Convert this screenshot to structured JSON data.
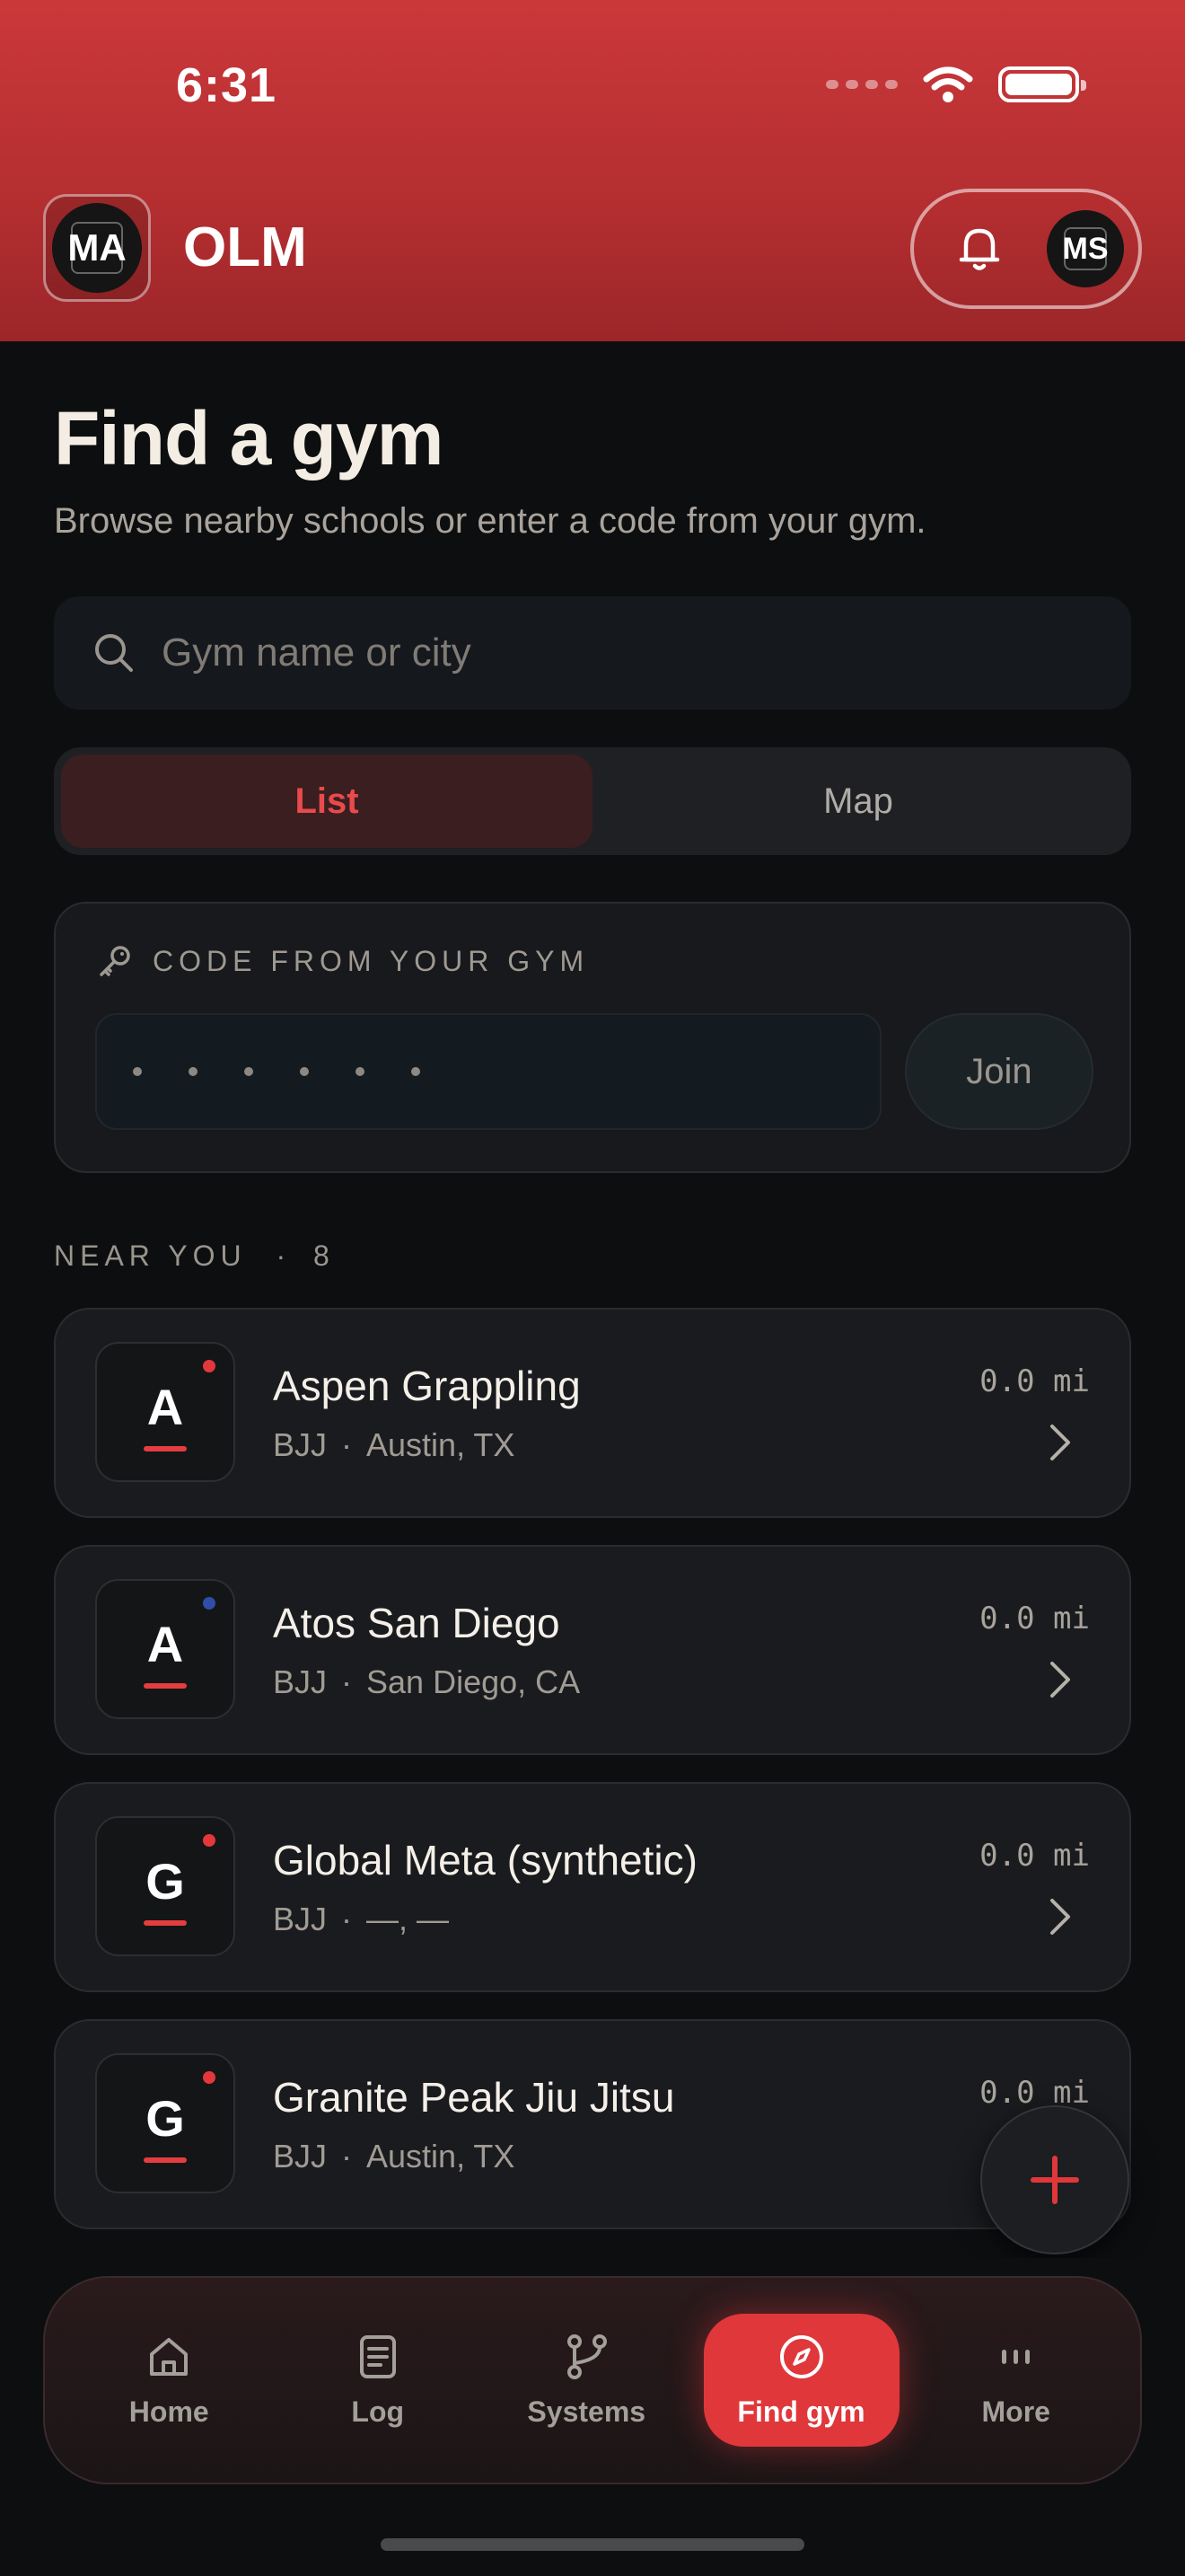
{
  "status_bar": {
    "time": "6:31"
  },
  "header": {
    "app_avatar_initials": "MA",
    "app_title": "OLM",
    "user_avatar_initials": "MS"
  },
  "page": {
    "title": "Find a gym",
    "subtitle": "Browse nearby schools or enter a code from your gym."
  },
  "search": {
    "placeholder": "Gym name or city"
  },
  "view_toggle": {
    "list_label": "List",
    "map_label": "Map",
    "selected": "List"
  },
  "code_card": {
    "label": "CODE FROM YOUR GYM",
    "join_label": "Join"
  },
  "near_you": {
    "label": "NEAR YOU",
    "separator": "·",
    "count": "8"
  },
  "gyms": [
    {
      "letter": "A",
      "name": "Aspen Grappling",
      "discipline": "BJJ",
      "sep": "·",
      "location": "Austin, TX",
      "distance": "0.0 mi",
      "dot_color": "#e3383b"
    },
    {
      "letter": "A",
      "name": "Atos San Diego",
      "discipline": "BJJ",
      "sep": "·",
      "location": "San Diego, CA",
      "distance": "0.0 mi",
      "dot_color": "#2f4ea8"
    },
    {
      "letter": "G",
      "name": "Global Meta (synthetic)",
      "discipline": "BJJ",
      "sep": "·",
      "location": "—, —",
      "distance": "0.0 mi",
      "dot_color": "#e3383b"
    },
    {
      "letter": "G",
      "name": "Granite Peak Jiu Jitsu",
      "discipline": "BJJ",
      "sep": "·",
      "location": "Austin, TX",
      "distance": "0.0 mi",
      "dot_color": "#e3383b"
    }
  ],
  "nav": {
    "home": "Home",
    "log": "Log",
    "systems": "Systems",
    "find_gym": "Find gym",
    "more": "More"
  },
  "colors": {
    "accent": "#e0373b",
    "header": "#c2333a",
    "background": "#0d0e10"
  }
}
